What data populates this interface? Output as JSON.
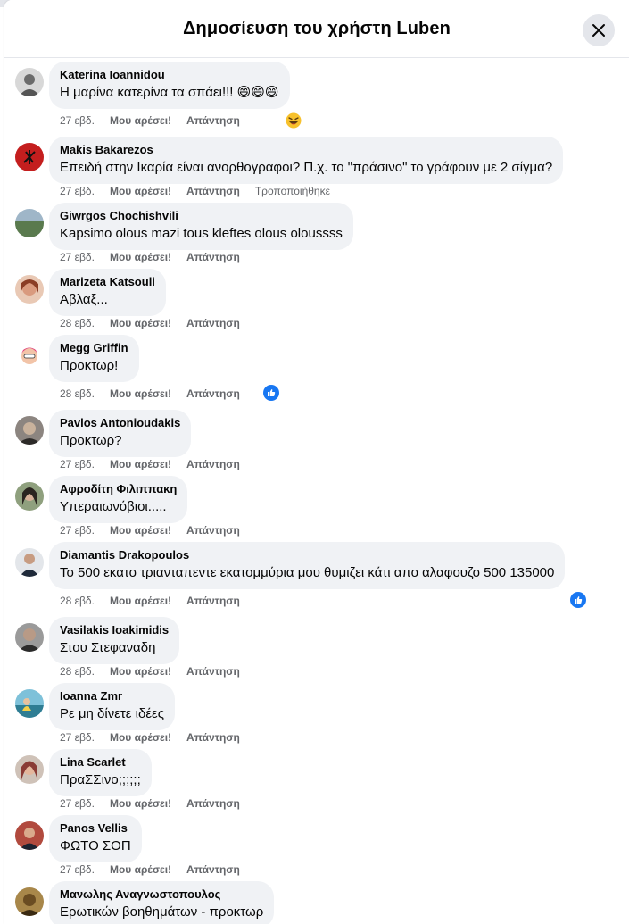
{
  "dialog": {
    "title": "Δημοσίευση του χρήστη Luben"
  },
  "labels": {
    "like": "Μου αρέσει!",
    "reply": "Απάντηση"
  },
  "colors": {
    "like_blue": "#1877f2",
    "bubble": "#f0f2f5",
    "meta_gray": "#65676b"
  },
  "comments": [
    {
      "author": "Katerina Ioannidou",
      "text": "Η μαρίνα κατερίνα τα σπάει!!! 😄😄😄",
      "time": "27 εβδ.",
      "reaction": "laugh-emoji",
      "avatar_color": "#6b6b6b"
    },
    {
      "author": "Makis Bakarezos",
      "text": "Επειδή στην Ικαρία είναι ανορθογραφοι? Π.χ. το \"πράσινο\" το γράφουν με 2 σίγμα?",
      "time": "27 εβδ.",
      "edited": "Τροποποιήθηκε",
      "avatar_color": "#c41e1e"
    },
    {
      "author": "Giwrgos Chochishvili",
      "text": "Kapsimo olous mazi tous kleftes olous oloussss",
      "time": "27 εβδ.",
      "avatar_color": "#5a7a4e"
    },
    {
      "author": "Marizeta Katsouli",
      "text": "Αβλαξ...",
      "time": "28 εβδ.",
      "avatar_color": "#b0654e"
    },
    {
      "author": "Megg Griffin",
      "text": "Προκτωρ!",
      "time": "28 εβδ.",
      "reaction": "like-badge",
      "avatar_color": "#e97fa8"
    },
    {
      "author": "Pavlos Antonioudakis",
      "text": "Προκτωρ?",
      "time": "27 εβδ.",
      "avatar_color": "#5d5550"
    },
    {
      "author": "Αφροδίτη Φιλιππακη",
      "text": "Υπεραιωνόβιοι.....",
      "time": "27 εβδ.",
      "avatar_color": "#4b5a45"
    },
    {
      "author": "Diamantis Drakopoulos",
      "text": "Το 500 εκατο τριανταπεντε εκατομμύρια μου θυμιζει κάτι απο αλαφουζο 500 135000",
      "time": "28 εβδ.",
      "reaction": "like-badge",
      "avatar_color": "#2b3545"
    },
    {
      "author": "Vasilakis Ioakimidis",
      "text": "Στου Στεφαναδη",
      "time": "28 εβδ.",
      "avatar_color": "#3d3d3d"
    },
    {
      "author": "Ioanna Zmr",
      "text": "Ρε μη δίνετε ιδέες",
      "time": "27 εβδ.",
      "avatar_color": "#3a8aa0"
    },
    {
      "author": "Lina Scarlet",
      "text": "ΠραΣΣινο;;;;;;",
      "time": "27 εβδ.",
      "avatar_color": "#8a3b35"
    },
    {
      "author": "Panos Vellis",
      "text": "ΦΩΤΟ ΣΟΠ",
      "time": "27 εβδ.",
      "avatar_color": "#6e2a2a"
    },
    {
      "author": "Μανωλης Αναγνωστοπουλος",
      "text": "Ερωτικών βοηθημάτων - προκτωρ",
      "time": "",
      "avatar_color": "#7a6030"
    }
  ]
}
